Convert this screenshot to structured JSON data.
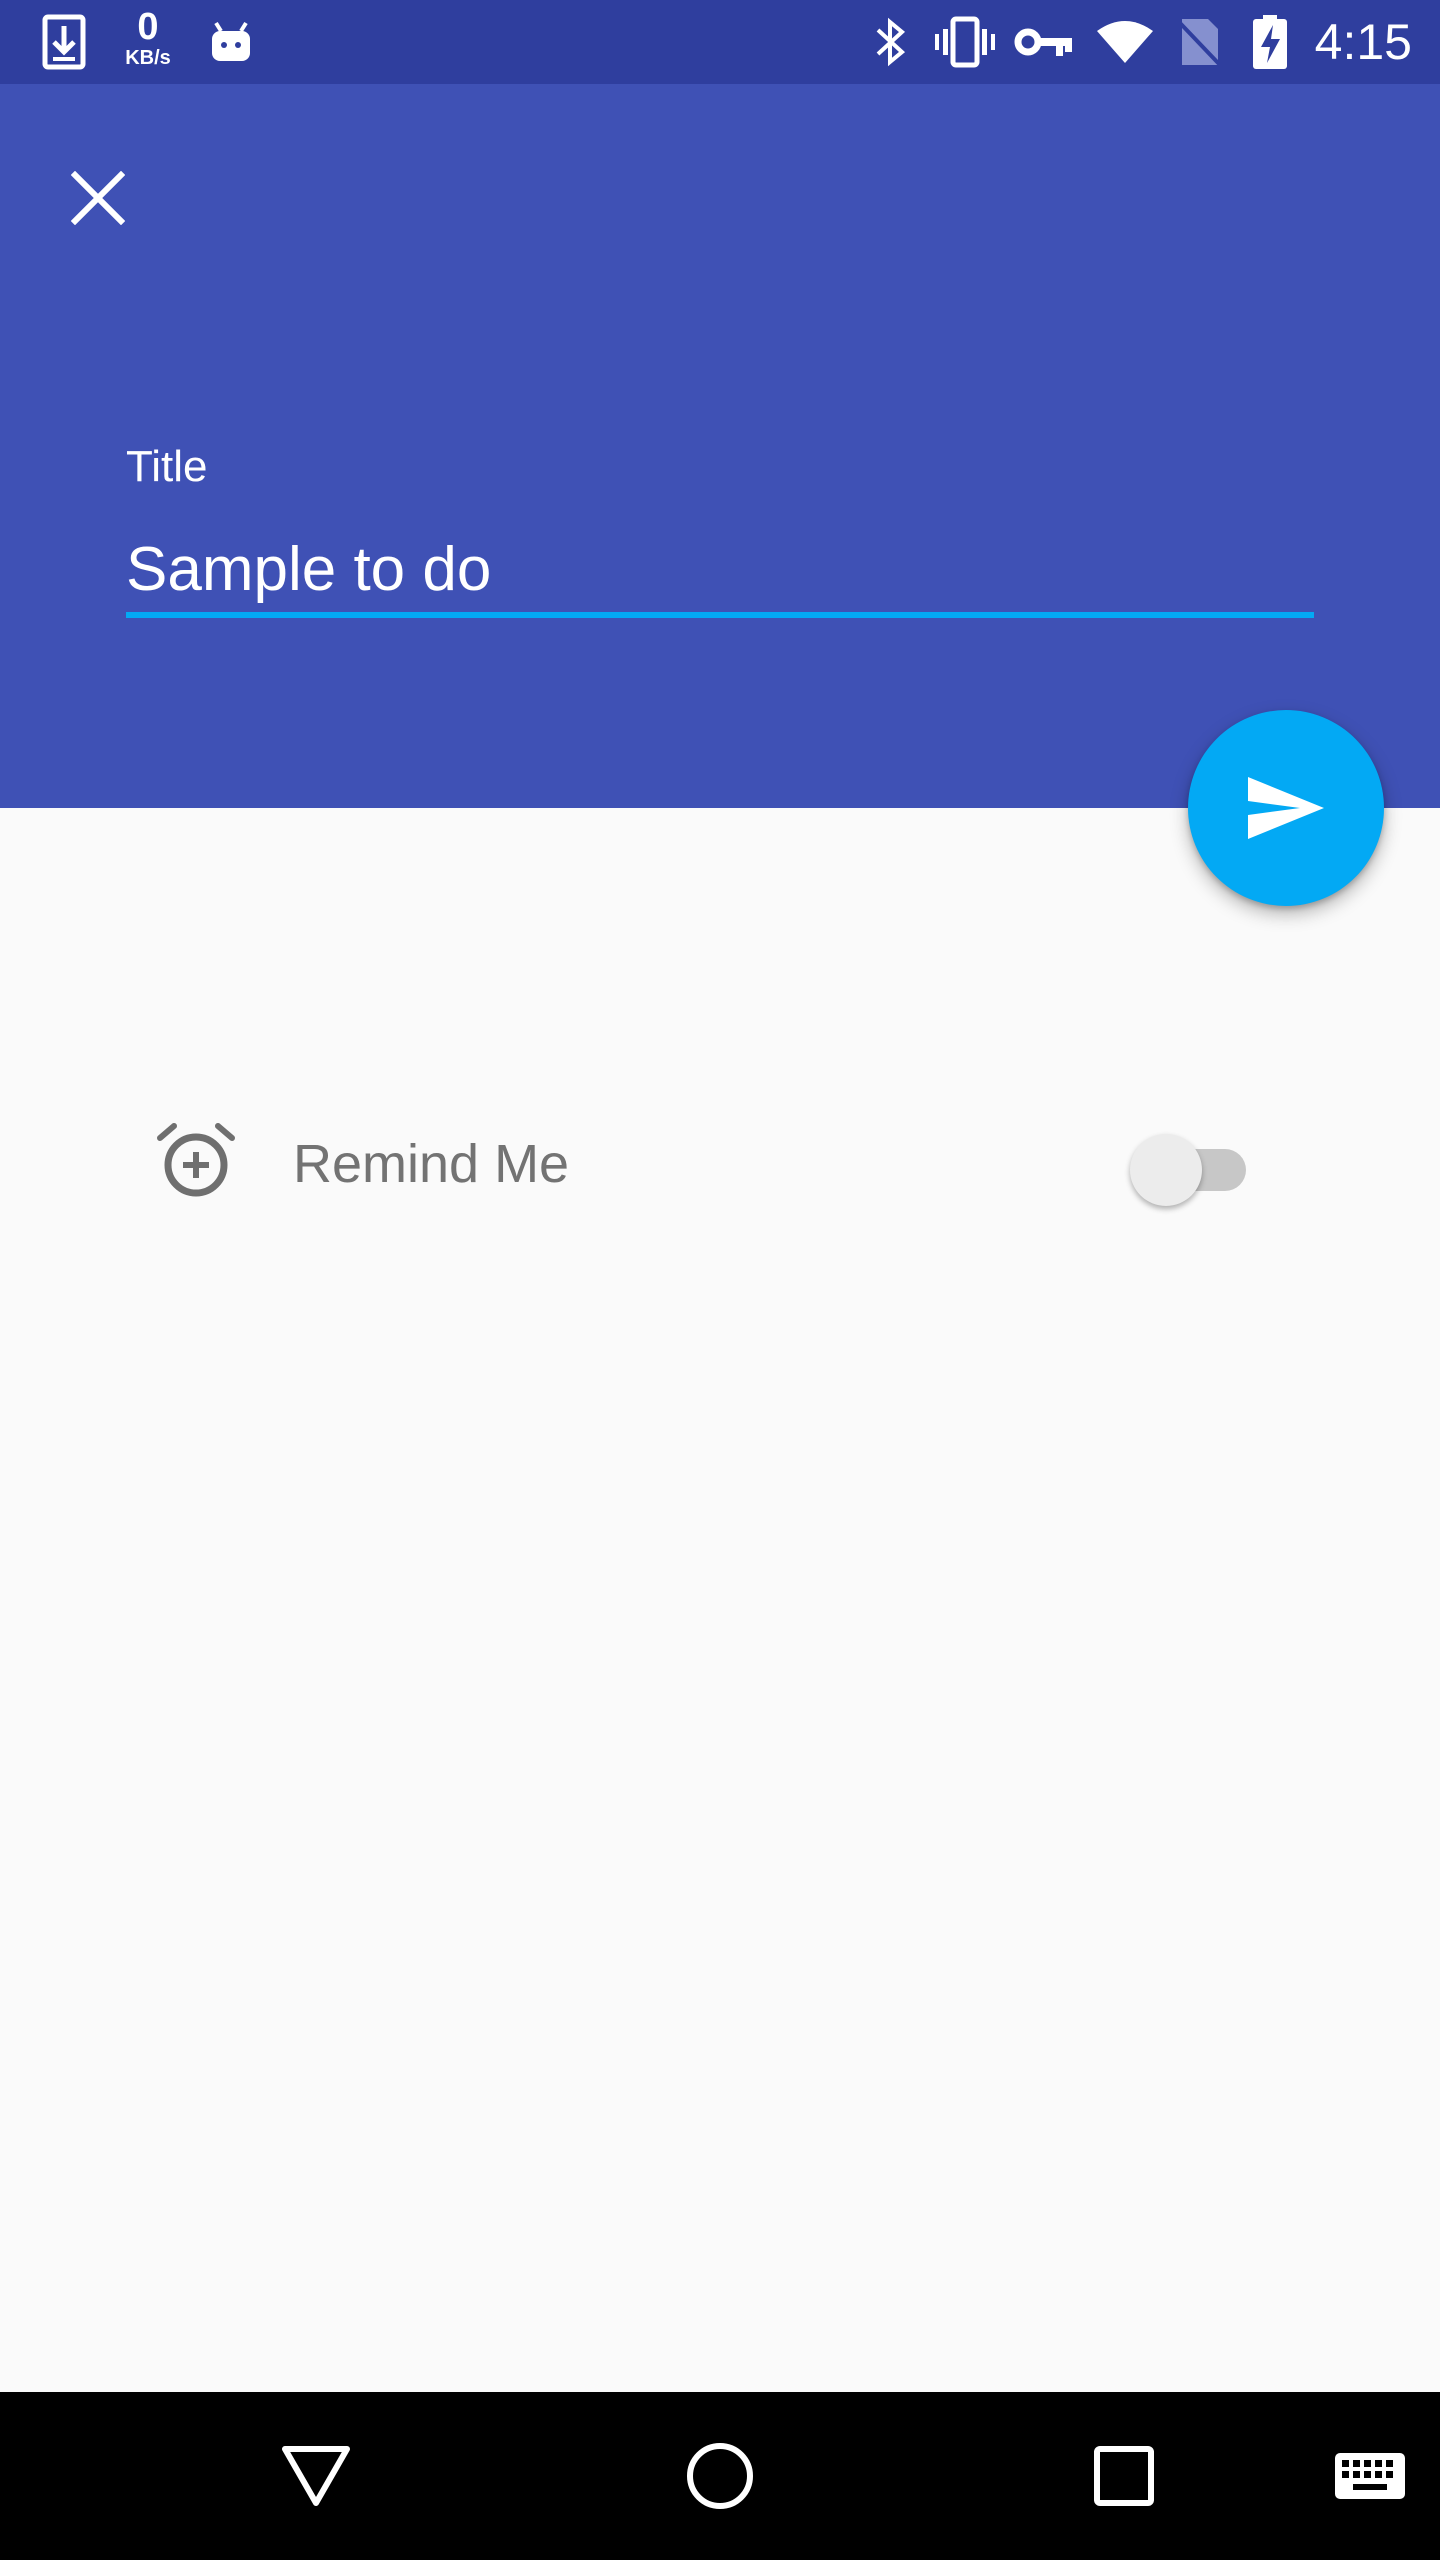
{
  "status_bar": {
    "icons": [
      "download-icon",
      "robot-icon",
      "bluetooth-icon",
      "vibrate-icon",
      "vpn-key-icon",
      "wifi-icon",
      "no-sim-icon",
      "battery-charging-icon"
    ],
    "net_speed_value": "0",
    "net_speed_unit": "KB/s",
    "time": "4:15"
  },
  "header": {
    "close_icon": "close-icon",
    "title_label": "Title",
    "title_value": "Sample to do",
    "background_color": "#3f51b5",
    "underline_color": "#03a9f4"
  },
  "fab": {
    "icon": "send-icon",
    "color": "#03a9f4"
  },
  "reminder": {
    "icon": "alarm-add-icon",
    "label": "Remind Me",
    "enabled": false
  },
  "nav_bar": {
    "buttons": [
      "back-icon",
      "home-icon",
      "recents-icon",
      "keyboard-icon"
    ]
  }
}
